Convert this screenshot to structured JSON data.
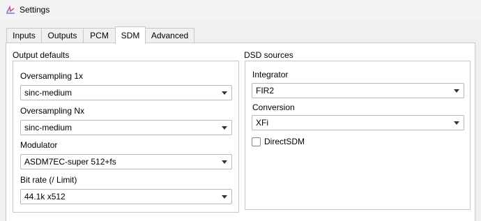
{
  "window": {
    "title": "Settings"
  },
  "tabs": [
    {
      "label": "Inputs"
    },
    {
      "label": "Outputs"
    },
    {
      "label": "PCM"
    },
    {
      "label": "SDM",
      "active": true
    },
    {
      "label": "Advanced"
    }
  ],
  "output_defaults": {
    "title": "Output defaults",
    "oversampling_1x": {
      "label": "Oversampling 1x",
      "value": "sinc-medium"
    },
    "oversampling_nx": {
      "label": "Oversampling Nx",
      "value": "sinc-medium"
    },
    "modulator": {
      "label": "Modulator",
      "value": "ASDM7EC-super 512+fs"
    },
    "bit_rate": {
      "label": "Bit rate (/ Limit)",
      "value": "44.1k x512"
    }
  },
  "dsd_sources": {
    "title": "DSD sources",
    "integrator": {
      "label": "Integrator",
      "value": "FIR2"
    },
    "conversion": {
      "label": "Conversion",
      "value": "XFi"
    },
    "direct_sdm": {
      "label": "DirectSDM",
      "checked": false
    }
  }
}
